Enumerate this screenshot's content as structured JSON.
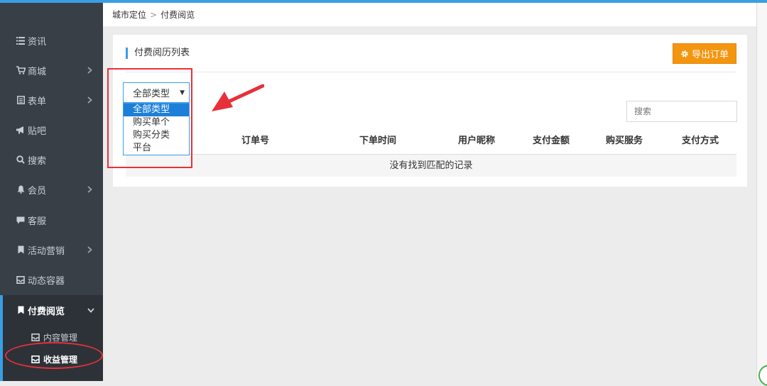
{
  "breadcrumb": {
    "parent": "城市定位",
    "separator": ">",
    "current": "付费阅览"
  },
  "sidebar": {
    "items": [
      {
        "label": "资讯",
        "icon": "list-icon",
        "has_children": false
      },
      {
        "label": "商城",
        "icon": "cart-icon",
        "has_children": true
      },
      {
        "label": "表单",
        "icon": "form-icon",
        "has_children": true
      },
      {
        "label": "贴吧",
        "icon": "megaphone-icon",
        "has_children": false
      },
      {
        "label": "搜索",
        "icon": "search-icon",
        "has_children": false
      },
      {
        "label": "会员",
        "icon": "bell-icon",
        "has_children": true
      },
      {
        "label": "客服",
        "icon": "chat-icon",
        "has_children": false
      },
      {
        "label": "活动营销",
        "icon": "bookmark-icon",
        "has_children": true
      },
      {
        "label": "动态容器",
        "icon": "inbox-icon",
        "has_children": false
      },
      {
        "label": "付费阅览",
        "icon": "bookmark-icon",
        "has_children": true,
        "expanded": true
      }
    ],
    "subitems": [
      {
        "label": "内容管理",
        "icon": "inbox-icon"
      },
      {
        "label": "收益管理",
        "icon": "inbox-icon",
        "current": true
      }
    ]
  },
  "card": {
    "title": "付费阅历列表",
    "export_label": "导出订单",
    "search_placeholder": "搜索"
  },
  "filter": {
    "selected": "全部类型",
    "options": [
      "全部类型",
      "购买单个",
      "购买分类",
      "平台"
    ]
  },
  "table": {
    "columns": [
      "订单号",
      "下单时间",
      "用户昵称",
      "支付金额",
      "购买服务",
      "支付方式"
    ],
    "empty_message": "没有找到匹配的记录"
  },
  "colors": {
    "accent": "#3a9ee4",
    "sidebar_bg": "#383f47",
    "export_button": "#f4950f",
    "annotation": "#e8303a",
    "option_highlight": "#1e7fd9"
  }
}
